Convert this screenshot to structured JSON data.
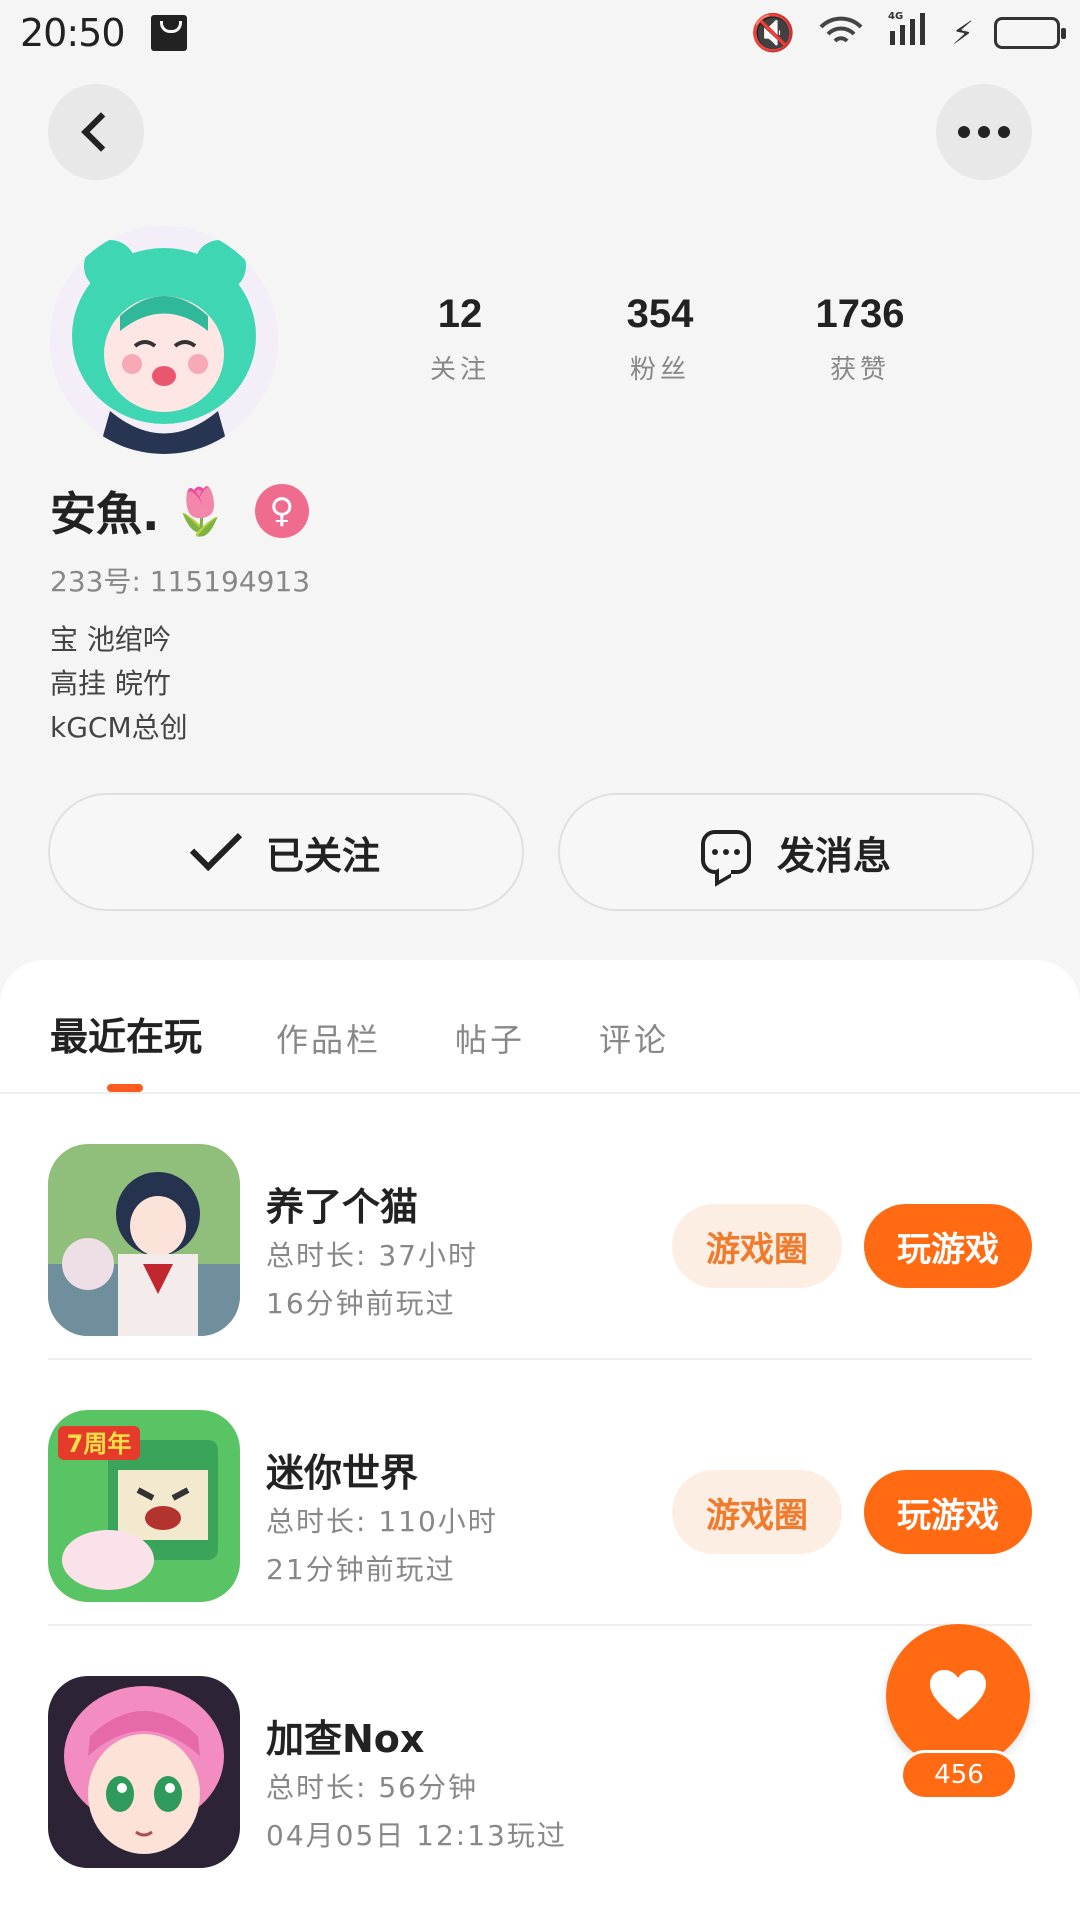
{
  "status_bar": {
    "time": "20:50",
    "icons": [
      "shopping-bag-icon",
      "mute-icon",
      "wifi-icon",
      "signal-4g-icon",
      "charging-icon",
      "battery-icon"
    ],
    "network_label": "4G"
  },
  "profile": {
    "name": "安魚.",
    "name_emoji": "🌷",
    "gender_symbol": "♀",
    "user_id": "233号: 115194913",
    "bio_lines": [
      "宝 池绾吟",
      "高挂 皖竹",
      "kGCM总创"
    ],
    "stats": [
      {
        "value": "12",
        "label": "关注"
      },
      {
        "value": "354",
        "label": "粉丝"
      },
      {
        "value": "1736",
        "label": "获赞"
      }
    ]
  },
  "actions": {
    "follow_label": "已关注",
    "message_label": "发消息"
  },
  "tabs": [
    {
      "label": "最近在玩",
      "active": true
    },
    {
      "label": "作品栏",
      "active": false
    },
    {
      "label": "帖子",
      "active": false
    },
    {
      "label": "评论",
      "active": false
    }
  ],
  "games": [
    {
      "title": "养了个猫",
      "duration": "总时长: 37小时",
      "last_played": "16分钟前玩过",
      "circle_label": "游戏圈",
      "play_label": "玩游戏"
    },
    {
      "title": "迷你世界",
      "duration": "总时长: 110小时",
      "last_played": "21分钟前玩过",
      "circle_label": "游戏圈",
      "play_label": "玩游戏",
      "badge": "7周年"
    },
    {
      "title": "加查Nox",
      "duration": "总时长: 56分钟",
      "last_played": "04月05日 12:13玩过"
    }
  ],
  "floating_like": {
    "count": "456"
  },
  "colors": {
    "accent": "#ff6a13",
    "accent_soft": "#fdeee3",
    "gender_pink": "#f06c8f",
    "background": "#f5f5f5"
  }
}
